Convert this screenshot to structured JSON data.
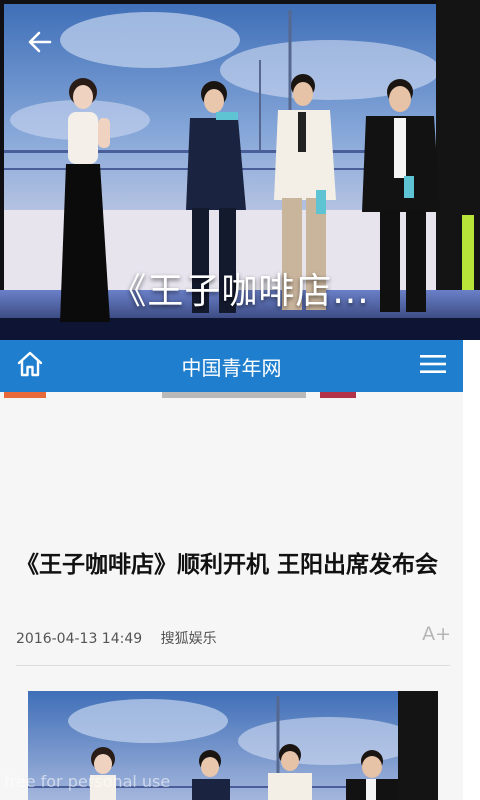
{
  "hero": {
    "caption": "《王子咖啡店...",
    "back_icon": "arrow-left-icon"
  },
  "header": {
    "title": "中国青年网",
    "home_icon": "home-icon",
    "menu_icon": "hamburger-menu-icon",
    "background_color": "#1f7fce"
  },
  "article": {
    "title": "《王子咖啡店》顺利开机 王阳出席发布会",
    "date": "2016-04-13 14:49",
    "source": "搜狐娱乐",
    "font_size_label": "A+"
  },
  "watermark": "free for personal use"
}
